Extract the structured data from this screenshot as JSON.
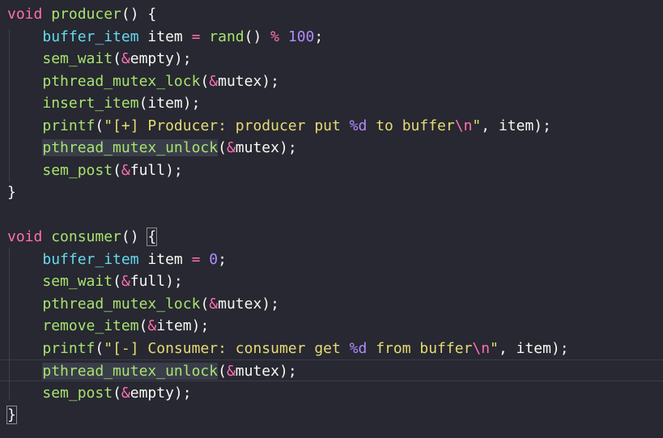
{
  "theme": {
    "background": "#272831",
    "keyword": "#ff6fb0",
    "function": "#a8e26f",
    "type": "#66d9ef",
    "string": "#e6db74",
    "number": "#b28bff",
    "plain": "#f8f8f2",
    "punct": "#ff6fb0"
  },
  "lines": [
    [
      {
        "t": "void",
        "c": "keyword"
      },
      {
        "t": " "
      },
      {
        "t": "producer",
        "c": "function"
      },
      {
        "t": "() {"
      }
    ],
    [
      {
        "t": "    "
      },
      {
        "t": "buffer_item",
        "c": "type"
      },
      {
        "t": " item "
      },
      {
        "t": "=",
        "c": "punct"
      },
      {
        "t": " "
      },
      {
        "t": "rand",
        "c": "function"
      },
      {
        "t": "() "
      },
      {
        "t": "%",
        "c": "punct"
      },
      {
        "t": " "
      },
      {
        "t": "100",
        "c": "number"
      },
      {
        "t": ";"
      }
    ],
    [
      {
        "t": "    "
      },
      {
        "t": "sem_wait",
        "c": "function"
      },
      {
        "t": "("
      },
      {
        "t": "&",
        "c": "punct"
      },
      {
        "t": "empty);"
      }
    ],
    [
      {
        "t": "    "
      },
      {
        "t": "pthread_mutex_lock",
        "c": "function"
      },
      {
        "t": "("
      },
      {
        "t": "&",
        "c": "punct"
      },
      {
        "t": "mutex);"
      }
    ],
    [
      {
        "t": "    "
      },
      {
        "t": "insert_item",
        "c": "function"
      },
      {
        "t": "(item);"
      }
    ],
    [
      {
        "t": "    "
      },
      {
        "t": "printf",
        "c": "function"
      },
      {
        "t": "("
      },
      {
        "t": "\"[+] Producer: producer put ",
        "c": "string"
      },
      {
        "t": "%d",
        "c": "number"
      },
      {
        "t": " to buffer",
        "c": "string"
      },
      {
        "t": "\\n",
        "c": "keyword"
      },
      {
        "t": "\"",
        "c": "string"
      },
      {
        "t": ", item);"
      }
    ],
    [
      {
        "t": "    "
      },
      {
        "t": "pthread_mutex_unlock",
        "c": "function",
        "hl": true
      },
      {
        "t": "("
      },
      {
        "t": "&",
        "c": "punct"
      },
      {
        "t": "mutex);"
      }
    ],
    [
      {
        "t": "    "
      },
      {
        "t": "sem_post",
        "c": "function"
      },
      {
        "t": "("
      },
      {
        "t": "&",
        "c": "punct"
      },
      {
        "t": "full);"
      }
    ],
    [
      {
        "t": "}"
      }
    ],
    [
      {
        "t": ""
      }
    ],
    [
      {
        "t": "void",
        "c": "keyword"
      },
      {
        "t": " "
      },
      {
        "t": "consumer",
        "c": "function"
      },
      {
        "t": "() "
      },
      {
        "t": "{",
        "box": true
      }
    ],
    [
      {
        "t": "    "
      },
      {
        "t": "buffer_item",
        "c": "type"
      },
      {
        "t": " item "
      },
      {
        "t": "=",
        "c": "punct"
      },
      {
        "t": " "
      },
      {
        "t": "0",
        "c": "number"
      },
      {
        "t": ";"
      }
    ],
    [
      {
        "t": "    "
      },
      {
        "t": "sem_wait",
        "c": "function"
      },
      {
        "t": "("
      },
      {
        "t": "&",
        "c": "punct"
      },
      {
        "t": "full);"
      }
    ],
    [
      {
        "t": "    "
      },
      {
        "t": "pthread_mutex_lock",
        "c": "function"
      },
      {
        "t": "("
      },
      {
        "t": "&",
        "c": "punct"
      },
      {
        "t": "mutex);"
      }
    ],
    [
      {
        "t": "    "
      },
      {
        "t": "remove_item",
        "c": "function"
      },
      {
        "t": "("
      },
      {
        "t": "&",
        "c": "punct"
      },
      {
        "t": "item);"
      }
    ],
    [
      {
        "t": "    "
      },
      {
        "t": "printf",
        "c": "function"
      },
      {
        "t": "("
      },
      {
        "t": "\"[-] Consumer: consumer get ",
        "c": "string"
      },
      {
        "t": "%d",
        "c": "number"
      },
      {
        "t": " from buffer",
        "c": "string"
      },
      {
        "t": "\\n",
        "c": "keyword"
      },
      {
        "t": "\"",
        "c": "string"
      },
      {
        "t": ", item);"
      }
    ],
    [
      {
        "t": "    "
      },
      {
        "t": "pthread_mutex_unlock",
        "c": "function",
        "hl": true
      },
      {
        "t": "("
      },
      {
        "t": "&",
        "c": "punct"
      },
      {
        "t": "mutex);"
      }
    ],
    [
      {
        "t": "    "
      },
      {
        "t": "sem_post",
        "c": "function"
      },
      {
        "t": "("
      },
      {
        "t": "&",
        "c": "punct"
      },
      {
        "t": "empty);"
      }
    ],
    [
      {
        "t": "}",
        "box": true
      }
    ]
  ],
  "active_line": 16
}
